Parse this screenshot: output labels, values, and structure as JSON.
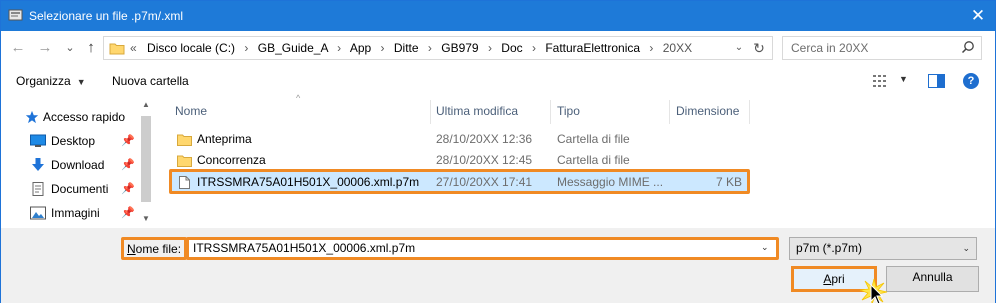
{
  "window": {
    "title": "Selezionare un file .p7m/.xml",
    "close_glyph": "✕"
  },
  "nav": {
    "back_glyph": "←",
    "forward_glyph": "→",
    "recent_glyph": "⌄",
    "up_glyph": "↑"
  },
  "address": {
    "overflow": "«",
    "crumbs": [
      "Disco locale (C:)",
      "GB_Guide_A",
      "App",
      "Ditte",
      "GB979",
      "Doc",
      "FatturaElettronica"
    ],
    "current": "20XX",
    "separator": "›",
    "dropdown_glyph": "⌄",
    "refresh_glyph": "↻"
  },
  "search": {
    "placeholder": "Cerca in 20XX",
    "icon": "search-icon"
  },
  "toolbar": {
    "organize_label": "Organizza",
    "organize_caret": "▼",
    "new_folder_label": "Nuova cartella",
    "view_caret": "▼",
    "help_label": "?"
  },
  "sidebar": {
    "items": [
      {
        "label": "Accesso rapido",
        "icon": "star-icon"
      },
      {
        "label": "Desktop",
        "icon": "desktop-icon",
        "pin": "📌"
      },
      {
        "label": "Download",
        "icon": "download-icon",
        "pin": "📌"
      },
      {
        "label": "Documenti",
        "icon": "documents-icon",
        "pin": "📌"
      },
      {
        "label": "Immagini",
        "icon": "images-icon",
        "pin": "📌"
      }
    ],
    "scroll_up": "▲",
    "scroll_down": "▼"
  },
  "files": {
    "columns": [
      "Nome",
      "Ultima modifica",
      "Tipo",
      "Dimensione"
    ],
    "sort_glyph": "^",
    "rows": [
      {
        "name": "Anteprima",
        "date": "28/10/20XX 12:36",
        "type": "Cartella di file",
        "size": "",
        "icon": "folder-icon"
      },
      {
        "name": "Concorrenza",
        "date": "28/10/20XX 12:45",
        "type": "Cartella di file",
        "size": "",
        "icon": "folder-icon"
      },
      {
        "name": "ITRSSMRA75A01H501X_00006.xml.p7m",
        "date": "27/10/20XX 17:41",
        "type": "Messaggio MIME ...",
        "size": "7 KB",
        "icon": "file-icon",
        "selected": true
      }
    ]
  },
  "footer": {
    "filename_label_accel": "N",
    "filename_label_rest": "ome file:",
    "filename_value": "ITRSSMRA75A01H501X_00006.xml.p7m",
    "filename_dd": "⌄",
    "filetype_value": "p7m (*.p7m)",
    "filetype_dd": "⌄",
    "open_accel": "A",
    "open_rest": "pri",
    "cancel_label": "Annulla"
  },
  "colors": {
    "titlebar": "#1e7ad8",
    "highlight": "#f08a24",
    "selection": "#cce8ff"
  }
}
